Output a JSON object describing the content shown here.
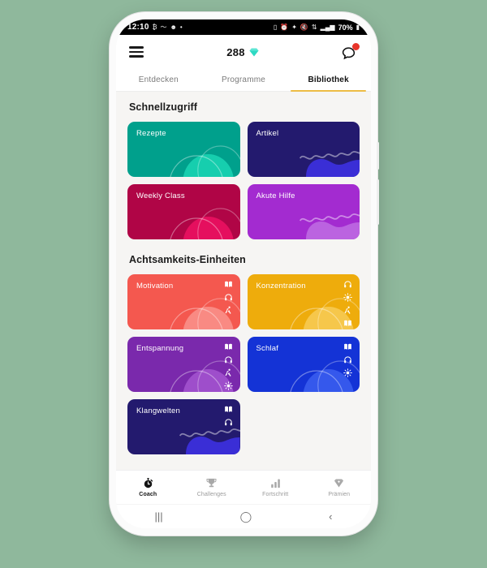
{
  "status_bar": {
    "time": "12:10",
    "left_icons": [
      "bitcoin-icon",
      "activity-icon",
      "smiley-icon",
      "dot-icon"
    ],
    "right_icons": [
      "vibrate-icon",
      "alarm-icon",
      "bluetooth-icon",
      "mute-icon",
      "wifi-off-icon",
      "signal-icon"
    ],
    "battery": "70%"
  },
  "app_header": {
    "menu_icon": "hamburger-menu-icon",
    "coins": "288",
    "coin_icon": "gem-icon",
    "coin_color": "#2ed9c3",
    "message_icon": "speech-bubble-icon",
    "badge_color": "#e8342a"
  },
  "tabs": {
    "items": [
      {
        "label": "Entdecken",
        "active": false
      },
      {
        "label": "Programme",
        "active": false
      },
      {
        "label": "Bibliothek",
        "active": true
      }
    ],
    "active_underline_color": "#edbc45"
  },
  "sections": [
    {
      "title": "Schnellzugriff",
      "cards": [
        {
          "label": "Rezepte",
          "color": "#00a08c",
          "accent": "#1ad6b4",
          "deco": "arcs",
          "icons": []
        },
        {
          "label": "Artikel",
          "color": "#231a6e",
          "accent": "#3a2ed6",
          "deco": "waves",
          "icons": []
        },
        {
          "label": "Weekly Class",
          "color": "#b00546",
          "accent": "#ee1263",
          "deco": "arcs",
          "icons": []
        },
        {
          "label": "Akute Hilfe",
          "color": "#a32bd0",
          "accent": "#bb63e0",
          "deco": "waves",
          "icons": []
        }
      ]
    },
    {
      "title": "Achtsamkeits-Einheiten",
      "cards": [
        {
          "label": "Motivation",
          "color": "#f4584f",
          "accent": "#f9938c",
          "deco": "arcs",
          "icons": [
            "book-icon",
            "headphones-icon",
            "running-icon"
          ]
        },
        {
          "label": "Konzentration",
          "color": "#eeac0c",
          "accent": "#f7cb57",
          "deco": "arcs",
          "icons": [
            "headphones-icon",
            "sparkle-icon",
            "running-icon",
            "book-icon"
          ]
        },
        {
          "label": "Entspannung",
          "color": "#7a29ac",
          "accent": "#a455d0",
          "deco": "arcs",
          "icons": [
            "book-icon",
            "headphones-icon",
            "running-icon",
            "sparkle-icon"
          ]
        },
        {
          "label": "Schlaf",
          "color": "#1433d6",
          "accent": "#3b5ff0",
          "deco": "arcs",
          "icons": [
            "book-icon",
            "headphones-icon",
            "sparkle-icon"
          ]
        },
        {
          "label": "Klangwelten",
          "color": "#231a6e",
          "accent": "#3a2ed6",
          "deco": "waves",
          "icons": [
            "book-icon",
            "headphones-icon"
          ]
        }
      ]
    }
  ],
  "bottom_nav": {
    "items": [
      {
        "label": "Coach",
        "icon": "stopwatch-icon",
        "active": true
      },
      {
        "label": "Challenges",
        "icon": "trophy-icon",
        "active": false
      },
      {
        "label": "Fortschritt",
        "icon": "bar-chart-icon",
        "active": false
      },
      {
        "label": "Prämien",
        "icon": "diamond-icon",
        "active": false
      }
    ]
  },
  "android_nav": {
    "recents": "|||",
    "home": "◯",
    "back": "‹"
  }
}
